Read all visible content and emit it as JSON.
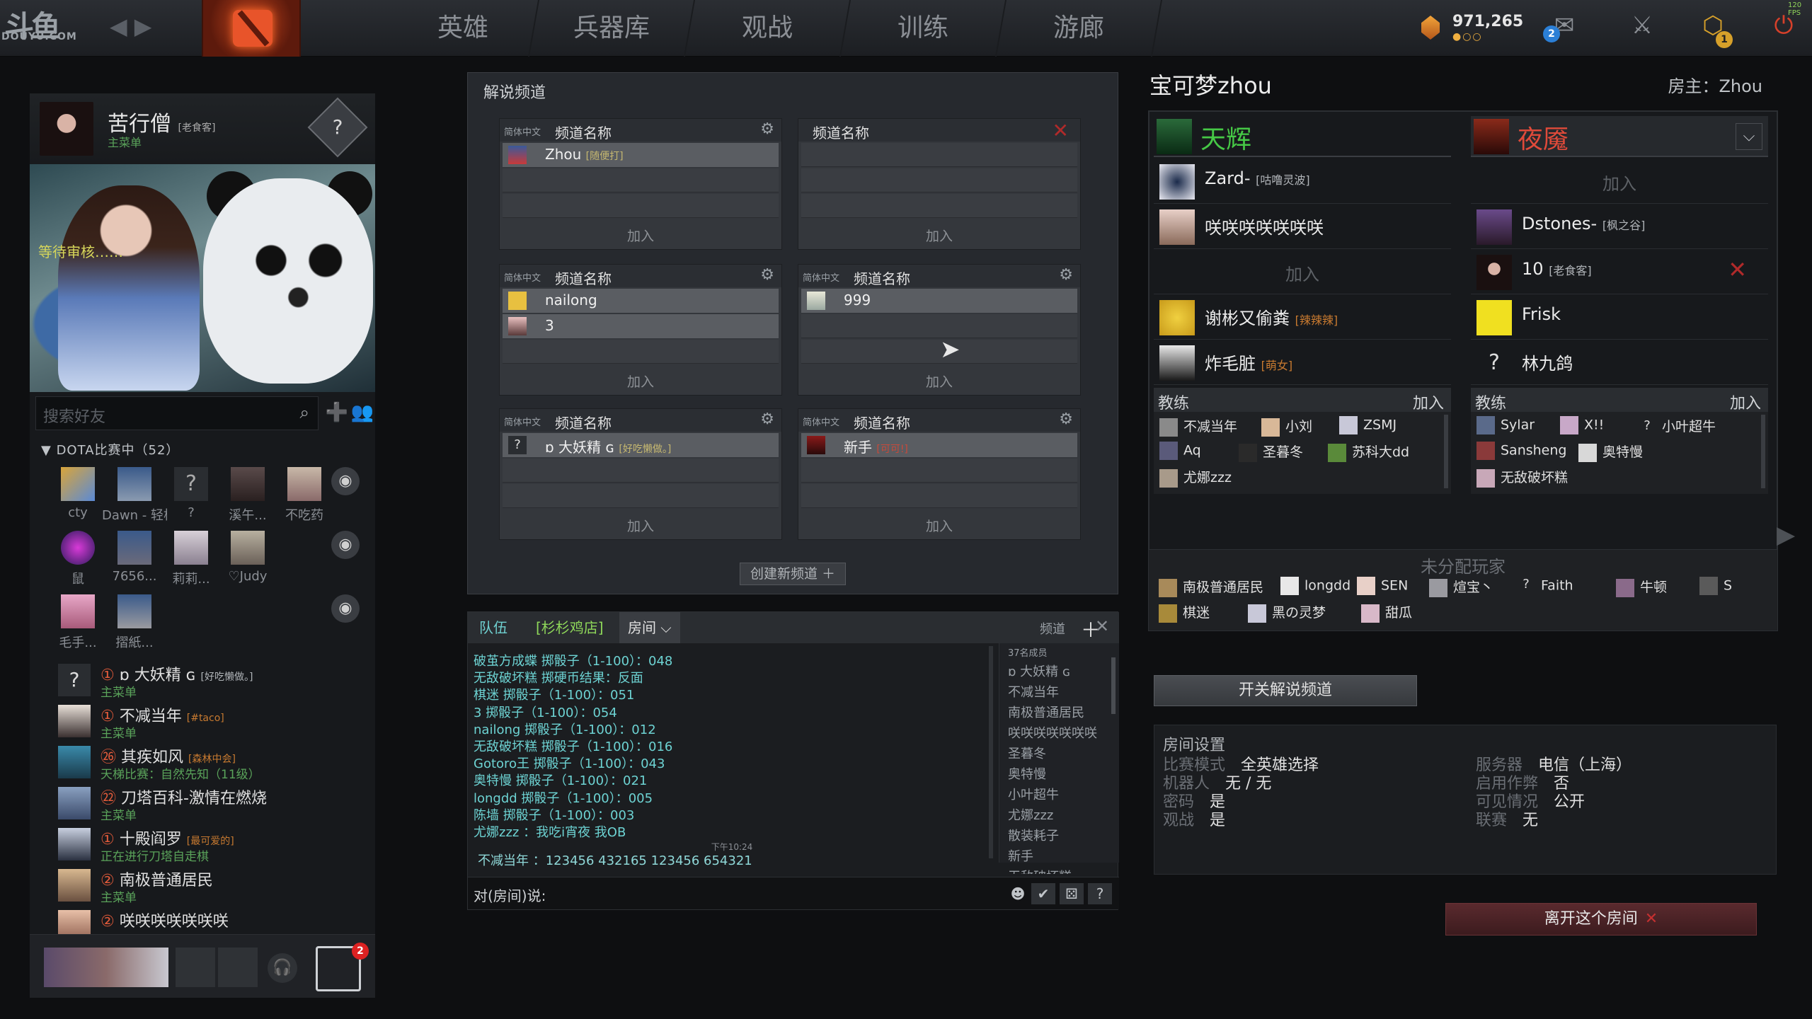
{
  "topbar": {
    "logo": "斗鱼",
    "logo_sub": "DOUYU.COM",
    "nav_arrows": "◀ ▶",
    "tabs": [
      "英雄",
      "兵器库",
      "观战",
      "训练",
      "游廊"
    ],
    "gold": "971,265",
    "gold_dots": "●○○",
    "mail_badge": "2",
    "shop_badge": "1",
    "fps": "120 FPS"
  },
  "profile": {
    "name": "苦行僧",
    "tag": "[老食客]",
    "status": "主菜单",
    "help": "?",
    "pending": "等待审核……"
  },
  "friends": {
    "search_placeholder": "搜索好友",
    "search_icon": "⌕",
    "add_icon": "➕",
    "group_icon": "👥",
    "group_header": "▼ DOTA比赛中（52）",
    "tiles_row1": [
      "cty",
      "Dawn - 轻松...",
      "?",
      "溪午...",
      "不吃药"
    ],
    "tiles_row2": [
      "鼠",
      "7656...",
      "莉莉...",
      "♡Judy"
    ],
    "tiles_row3": [
      "毛手...",
      "摺紙..."
    ],
    "list": [
      {
        "level": "①",
        "name": "ɒ 大妖精 ɢ",
        "tag": "[好吃懒做。]",
        "status": "主菜单"
      },
      {
        "level": "①",
        "name": "不减当年",
        "tag": "[#taco]",
        "status": "主菜单"
      },
      {
        "level": "㉖",
        "name": "其疾如风",
        "tag": "[森林中会]",
        "status": "天梯比赛：自然先知（11级）"
      },
      {
        "level": "㉒",
        "name": "刀塔百科-激情在燃烧",
        "tag": "",
        "status": "主菜单"
      },
      {
        "level": "①",
        "name": "十殿阎罗",
        "tag": "[最可爱的]",
        "status": "正在进行刀塔自走棋"
      },
      {
        "level": "②",
        "name": "南极普通居民",
        "tag": "",
        "status": "主菜单"
      },
      {
        "level": "②",
        "name": "咲咲咲咲咲咲咲",
        "tag": "",
        "status": ""
      }
    ],
    "chat_badge": "2",
    "headset_icon": "🎧"
  },
  "channels": {
    "title": "解说频道",
    "lang": "简体中文",
    "name_label": "频道名称",
    "join": "加入",
    "gear": "⚙",
    "close": "✕",
    "card1": {
      "members": [
        {
          "name": "Zhou",
          "tag": "[随便打]"
        }
      ]
    },
    "card3": {
      "members": [
        {
          "name": "nailong",
          "tag": ""
        },
        {
          "name": "3",
          "tag": ""
        }
      ]
    },
    "card4": {
      "members": [
        {
          "name": "999",
          "tag": ""
        }
      ]
    },
    "card5": {
      "members": [
        {
          "name": "ɒ 大妖精 ɢ",
          "tag": "[好吃懒做。]"
        }
      ]
    },
    "card6": {
      "members": [
        {
          "name": "新手",
          "tag": "[可可!]"
        }
      ]
    },
    "create": "创建新频道 ＋"
  },
  "chat": {
    "tabs": [
      "队伍",
      "[杉杉鸡店]",
      "房间 ⌵"
    ],
    "channel_label": "频道",
    "plus": "＋",
    "close": "✕",
    "log": [
      "破茧方成蝶 掷骰子（1-100）：048",
      "无敌破坏糕 掷硬币结果：反面",
      "棋迷 掷骰子（1-100）：051",
      "3 掷骰子（1-100）：054",
      "nailong 掷骰子（1-100）：012",
      "无敌破坏糕 掷骰子（1-100）：016",
      "Gotoro王 掷骰子（1-100）：043",
      "奥特慢 掷骰子（1-100）：021",
      "longdd 掷骰子（1-100）：005",
      "陈墙 掷骰子（1-100）：003",
      "尤娜zzz ：我吃i宵夜 我OB"
    ],
    "time": "下午10:24",
    "last": "不减当年 ：123456 432165 123456 654321",
    "member_count": "37名成员",
    "members": [
      "ɒ 大妖精 ɢ",
      "不减当年",
      "南极普通居民",
      "咲咲咲咲咲咲咲",
      "圣暮冬",
      "奥特慢",
      "小叶超牛",
      "尤娜zzz",
      "散装耗子",
      "新手",
      "无敌破坏糕"
    ],
    "input_label": "对(房间)说:",
    "btn_emoji": "☻",
    "btn_check": "✔",
    "btn_roll": "⚄",
    "btn_help": "?"
  },
  "lobby": {
    "title": "宝可梦zhou",
    "host": "房主：Zhou",
    "radiant": "天辉",
    "dire": "夜魇",
    "dropdown": "⌵",
    "join": "加入",
    "radiant_slots": [
      {
        "name": "Zard-",
        "tag": "[咕噜灵波]",
        "empty": false
      },
      {
        "name": "咲咲咲咲咲咲咲",
        "tag": "",
        "empty": false
      },
      {
        "name": "",
        "tag": "",
        "empty": true
      },
      {
        "name": "谢彬又偷粪",
        "tag": "[辣辣辣]",
        "empty": false
      },
      {
        "name": "炸毛脏",
        "tag": "[萌女]",
        "empty": false
      }
    ],
    "dire_slots": [
      {
        "name": "",
        "tag": "",
        "empty": true
      },
      {
        "name": "Dstones-",
        "tag": "[枫之谷]",
        "empty": false
      },
      {
        "name": "10",
        "tag": "[老食客]",
        "empty": false
      },
      {
        "name": "Frisk",
        "tag": "",
        "empty": false
      },
      {
        "name": "林九鸽",
        "tag": "",
        "empty": false
      }
    ],
    "coach_label": "教练",
    "radiant_coaches": [
      "不减当年",
      "小刘",
      "ZSMJ",
      "Aq",
      "圣暮冬",
      "苏科大dd",
      "尤娜zzz"
    ],
    "dire_coaches": [
      "Sylar",
      "X!!",
      "小叶超牛",
      "Sansheng",
      "奥特慢",
      "无敌破坏糕"
    ],
    "unassigned_title": "未分配玩家",
    "unassigned": [
      "南极普通居民",
      "longdd",
      "SEN",
      "煊宝丶",
      "Faith",
      "牛顿",
      "S",
      "棋迷",
      "黑の灵梦",
      "甜瓜"
    ],
    "cast_toggle": "开关解说频道",
    "settings_title": "房间设置",
    "settings": {
      "mode_k": "比赛模式",
      "mode_v": "全英雄选择",
      "bots_k": "机器人",
      "bots_v": "无 / 无",
      "pw_k": "密码",
      "pw_v": "是",
      "spec_k": "观战",
      "spec_v": "是",
      "server_k": "服务器",
      "server_v": "电信（上海）",
      "cheats_k": "启用作弊",
      "cheats_v": "否",
      "vis_k": "可见情况",
      "vis_v": "公开",
      "league_k": "联赛",
      "league_v": "无"
    },
    "leave": "离开这个房间",
    "leave_x": "✕",
    "radiant_color": "#46c846",
    "dire_color": "#e04a3a"
  }
}
